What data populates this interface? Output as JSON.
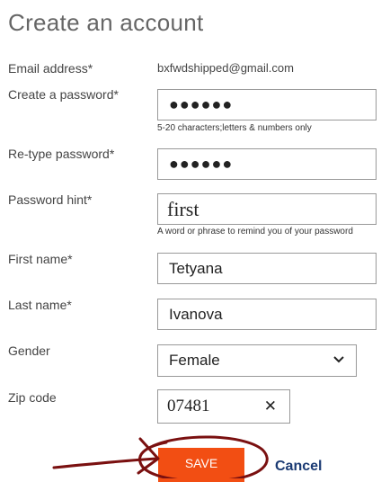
{
  "page": {
    "title": "Create an account"
  },
  "form": {
    "email": {
      "label": "Email address*",
      "value": "bxfwdshipped@gmail.com"
    },
    "password": {
      "label": "Create a password*",
      "value": "●●●●●●",
      "help": "5-20 characters;letters & numbers only"
    },
    "retype_password": {
      "label": "Re-type password*",
      "value": "●●●●●●"
    },
    "password_hint": {
      "label": "Password hint*",
      "value": "first",
      "help": "A word or phrase to remind you of your password"
    },
    "first_name": {
      "label": "First name*",
      "value": "Tetyana"
    },
    "last_name": {
      "label": "Last name*",
      "value": "Ivanova"
    },
    "gender": {
      "label": "Gender",
      "selected": "Female"
    },
    "zip": {
      "label": "Zip code",
      "value": "07481",
      "clear_symbol": "✕"
    }
  },
  "actions": {
    "save_label": "SAVE",
    "cancel_label": "Cancel"
  },
  "colors": {
    "save_button": "#f24e13",
    "cancel_link": "#1a3a73",
    "annotation_ink": "#7a1010"
  },
  "icons": {
    "select_chevron": "chevron-down-icon",
    "clear": "close-icon",
    "annotation": "red-arrow-and-circle"
  }
}
